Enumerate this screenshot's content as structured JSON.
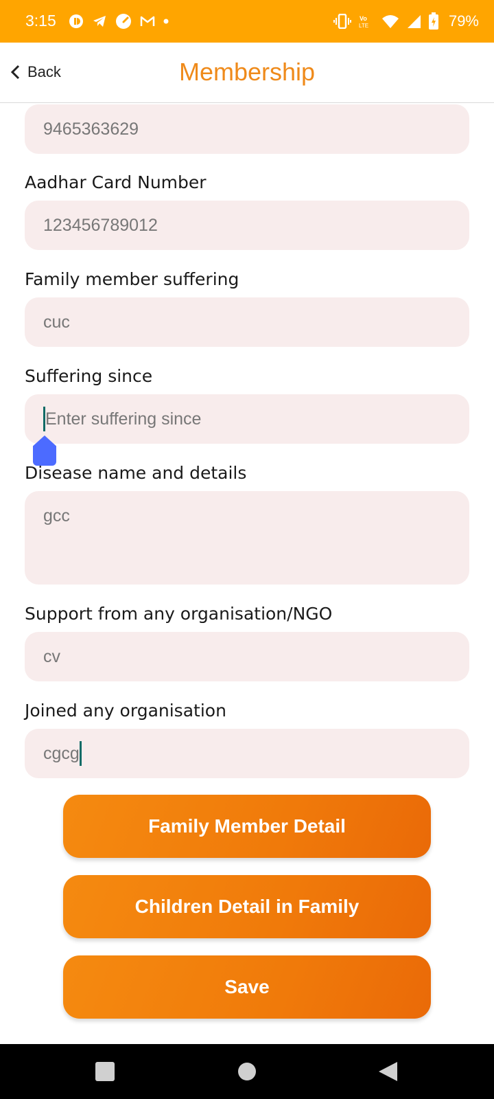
{
  "status_bar": {
    "time": "3:15",
    "battery": "79%",
    "background": "#FFA500",
    "icons": [
      "notification-icon",
      "telegram-icon",
      "speed-icon",
      "gmail-icon",
      "dot-icon",
      "vibrate-icon",
      "volte-icon",
      "wifi-icon",
      "signal-icon",
      "battery-charging-icon"
    ]
  },
  "header": {
    "back_label": "Back",
    "title": "Membership",
    "title_color": "#EF8A1A"
  },
  "form": {
    "phone_value": "9465363629",
    "aadhar_label": "Aadhar Card Number",
    "aadhar_value": "123456789012",
    "family_member_label": "Family member suffering",
    "family_member_value": "cuc",
    "suffering_since_label": "Suffering since",
    "suffering_since_placeholder": "Enter suffering since",
    "disease_label": "Disease name and details",
    "disease_value": "gcc",
    "support_label": "Support from any organisation/NGO",
    "support_value": "cv",
    "joined_label": "Joined any organisation",
    "joined_value": "cgcg",
    "field_background": "#F8ECEC"
  },
  "buttons": {
    "family_member_detail": "Family Member Detail",
    "children_detail": "Children Detail in Family",
    "save": "Save",
    "color": "#F07A0A"
  },
  "nav_bar": {
    "icons": [
      "recents-square-icon",
      "home-circle-icon",
      "back-triangle-icon"
    ]
  }
}
